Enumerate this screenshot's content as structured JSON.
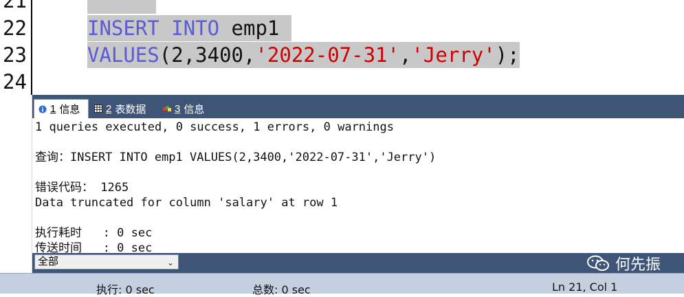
{
  "editor": {
    "lines": [
      {
        "num": "21"
      },
      {
        "num": "22",
        "kw1": "INSERT",
        "kw2": "INTO",
        "text": "emp1"
      },
      {
        "num": "23",
        "kw": "VALUES",
        "p1": "(2,3400,",
        "s1": "'2022-07-31'",
        "comma": ",",
        "s2": "'Jerry'",
        "end": ");"
      },
      {
        "num": "24"
      }
    ]
  },
  "tabs": [
    {
      "num": "1",
      "label": "信息",
      "icon": "info-icon"
    },
    {
      "num": "2",
      "label": "表数据",
      "icon": "table-icon"
    },
    {
      "num": "3",
      "label": "信息",
      "icon": "message-icon"
    }
  ],
  "output": {
    "summary": "1 queries executed, 0 success, 1 errors, 0 warnings",
    "query": "查询：INSERT INTO emp1 VALUES(2,3400,'2022-07-31','Jerry')",
    "error_code_label": "错误代码：",
    "error_code": "1265",
    "error_message": "Data truncated for column 'salary' at row 1",
    "exec_time": "执行耗时   : 0 sec",
    "transfer_time": "传送时间   : 0 sec"
  },
  "filter": {
    "selected": "全部"
  },
  "watermark": {
    "text": "何先振"
  },
  "status": {
    "exec": "执行: 0 sec",
    "total": "总数: 0 sec",
    "position": "Ln 21, Col 1"
  },
  "colors": {
    "keyword": "#5b5bd6",
    "string": "#d00000",
    "panel": "#3f5578",
    "statusbar": "#c4cfdf",
    "selection": "#c8c8c8"
  }
}
